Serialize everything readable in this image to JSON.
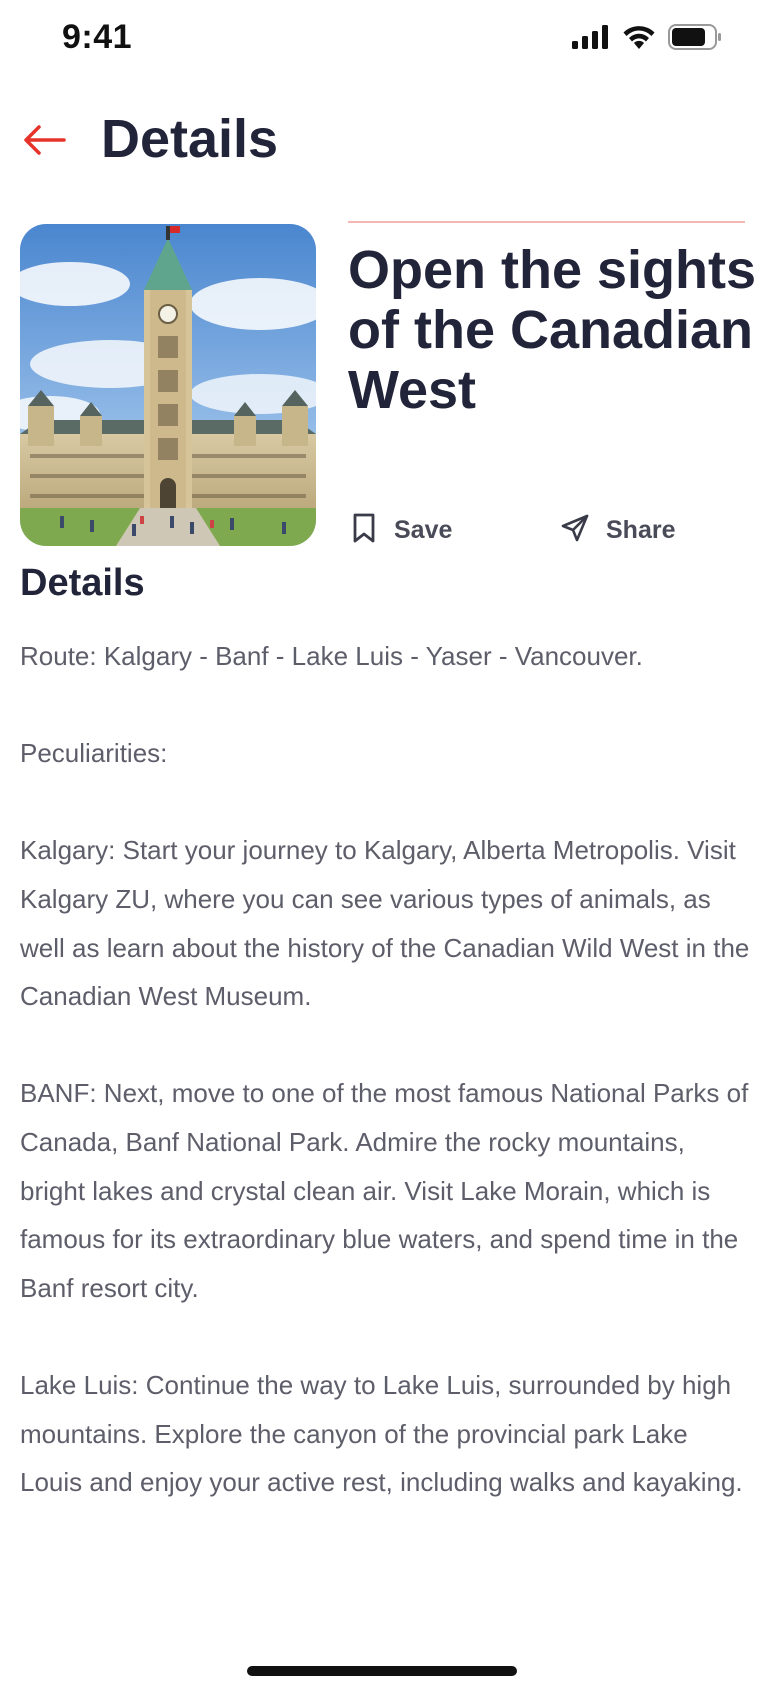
{
  "status_bar": {
    "time": "9:41"
  },
  "header": {
    "title": "Details"
  },
  "card": {
    "title": "Open the sights of the Canadian West"
  },
  "actions": {
    "save": "Save",
    "share": "Share"
  },
  "section": {
    "heading": "Details"
  },
  "description": {
    "paragraphs": [
      "Route: Kalgary - Banf - Lake Luis - Yaser - Vancouver.",
      "Peculiarities:",
      "Kalgary: Start your journey to Kalgary, Alberta Metropolis. Visit Kalgary ZU, where you can see various types of animals, as well as learn about the history of the Canadian Wild West in the Canadian West Museum.",
      "BANF: Next, move to one of the most famous National Parks of Canada, Banf National Park. Admire the rocky mountains, bright lakes and crystal clean air. Visit Lake Morain, which is famous for its extraordinary blue waters, and spend time in the Banf resort city.",
      "Lake Luis: Continue the way to Lake Luis, surrounded by high mountains. Explore the canyon of the provincial park Lake Louis and enjoy your active rest, including walks and kayaking."
    ]
  },
  "colors": {
    "accent": "#e5332a",
    "title": "#22243a",
    "body_text": "#5d5e6a",
    "rule": "#f4b7b3"
  },
  "icons": {
    "back": "arrow-left-icon",
    "save": "bookmark-icon",
    "share": "send-icon"
  }
}
